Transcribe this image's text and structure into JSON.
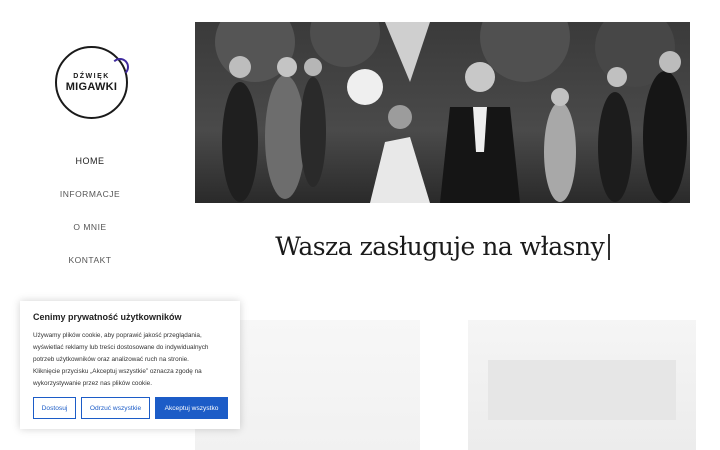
{
  "logo": {
    "line1": "DŹWIĘK",
    "line2": "MIGAWKI"
  },
  "nav": {
    "items": [
      {
        "label": "HOME"
      },
      {
        "label": "INFORMACJE"
      },
      {
        "label": "O MNIE"
      },
      {
        "label": "KONTAKT"
      }
    ]
  },
  "hero": {
    "description_icon": "wedding-photo"
  },
  "headline": {
    "text": "Wasza zasługuje na własny"
  },
  "cookie": {
    "title": "Cenimy prywatność użytkowników",
    "text_lines": [
      "Używamy plików cookie, aby poprawić jakość przeglądania,",
      "wyświetlać reklamy lub treści dostosowane do indywidualnych",
      "potrzeb użytkowników oraz analizować ruch na stronie.",
      "Kliknięcie przycisku „Akceptuj wszystkie” oznacza zgodę na",
      "wykorzystywanie przez nas plików cookie."
    ],
    "buttons": {
      "customize": "Dostosuj",
      "reject": "Odrzuć wszystkie",
      "accept": "Akceptuj wszystko"
    }
  },
  "colors": {
    "accent": "#1c5cc7",
    "logo_accent": "#3f2a9e"
  }
}
